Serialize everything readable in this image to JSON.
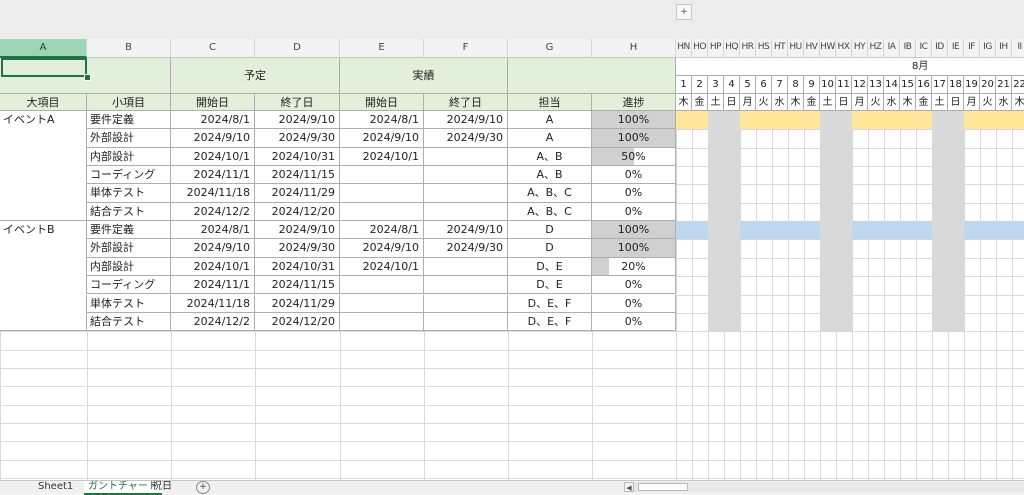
{
  "toolbar": {
    "split_label": "+"
  },
  "columns": [
    "A",
    "B",
    "C",
    "D",
    "E",
    "F",
    "G",
    "H"
  ],
  "gantt_columns": [
    "HN",
    "HO",
    "HP",
    "HQ",
    "HR",
    "HS",
    "HT",
    "HU",
    "HV",
    "HW",
    "HX",
    "HY",
    "HZ",
    "IA",
    "IB",
    "IC",
    "ID",
    "IE",
    "IF",
    "IG",
    "IH",
    "II"
  ],
  "selected_column": "A",
  "group_headers": {
    "plan": "予定",
    "actual": "実績"
  },
  "sub_headers": [
    "大項目",
    "小項目",
    "開始日",
    "終了日",
    "開始日",
    "終了日",
    "担当",
    "進捗"
  ],
  "month_label": "8月",
  "days": [
    "1",
    "2",
    "3",
    "4",
    "5",
    "6",
    "7",
    "8",
    "9",
    "10",
    "11",
    "12",
    "13",
    "14",
    "15",
    "16",
    "17",
    "18",
    "19",
    "20",
    "21",
    "22"
  ],
  "weekdays": [
    "木",
    "金",
    "土",
    "日",
    "月",
    "火",
    "水",
    "木",
    "金",
    "土",
    "日",
    "月",
    "火",
    "水",
    "木",
    "金",
    "土",
    "日",
    "月",
    "火",
    "水",
    "木"
  ],
  "weekend_indices": [
    2,
    3,
    9,
    10,
    16,
    17
  ],
  "rows": [
    {
      "major": "イベントA",
      "minor": "要件定義",
      "plan_start": "2024/8/1",
      "plan_end": "2024/9/10",
      "act_start": "2024/8/1",
      "act_end": "2024/9/10",
      "owner": "A",
      "progress": "100%",
      "progress_value": 1.0
    },
    {
      "major": "",
      "minor": "外部設計",
      "plan_start": "2024/9/10",
      "plan_end": "2024/9/30",
      "act_start": "2024/9/10",
      "act_end": "2024/9/30",
      "owner": "A",
      "progress": "100%",
      "progress_value": 1.0
    },
    {
      "major": "",
      "minor": "内部設計",
      "plan_start": "2024/10/1",
      "plan_end": "2024/10/31",
      "act_start": "2024/10/1",
      "act_end": "",
      "owner": "A、B",
      "progress": "50%",
      "progress_value": 0.5
    },
    {
      "major": "",
      "minor": "コーディング",
      "plan_start": "2024/11/1",
      "plan_end": "2024/11/15",
      "act_start": "",
      "act_end": "",
      "owner": "A、B",
      "progress": "0%",
      "progress_value": 0
    },
    {
      "major": "",
      "minor": "単体テスト",
      "plan_start": "2024/11/18",
      "plan_end": "2024/11/29",
      "act_start": "",
      "act_end": "",
      "owner": "A、B、C",
      "progress": "0%",
      "progress_value": 0
    },
    {
      "major": "",
      "minor": "結合テスト",
      "plan_start": "2024/12/2",
      "plan_end": "2024/12/20",
      "act_start": "",
      "act_end": "",
      "owner": "A、B、C",
      "progress": "0%",
      "progress_value": 0
    },
    {
      "major": "イベントB",
      "minor": "要件定義",
      "plan_start": "2024/8/1",
      "plan_end": "2024/9/10",
      "act_start": "2024/8/1",
      "act_end": "2024/9/10",
      "owner": "D",
      "progress": "100%",
      "progress_value": 1.0
    },
    {
      "major": "",
      "minor": "外部設計",
      "plan_start": "2024/9/10",
      "plan_end": "2024/9/30",
      "act_start": "2024/9/10",
      "act_end": "2024/9/30",
      "owner": "D",
      "progress": "100%",
      "progress_value": 1.0
    },
    {
      "major": "",
      "minor": "内部設計",
      "plan_start": "2024/10/1",
      "plan_end": "2024/10/31",
      "act_start": "2024/10/1",
      "act_end": "",
      "owner": "D、E",
      "progress": "20%",
      "progress_value": 0.2
    },
    {
      "major": "",
      "minor": "コーディング",
      "plan_start": "2024/11/1",
      "plan_end": "2024/11/15",
      "act_start": "",
      "act_end": "",
      "owner": "D、E",
      "progress": "0%",
      "progress_value": 0
    },
    {
      "major": "",
      "minor": "単体テスト",
      "plan_start": "2024/11/18",
      "plan_end": "2024/11/29",
      "act_start": "",
      "act_end": "",
      "owner": "D、E、F",
      "progress": "0%",
      "progress_value": 0
    },
    {
      "major": "",
      "minor": "結合テスト",
      "plan_start": "2024/12/2",
      "plan_end": "2024/12/20",
      "act_start": "",
      "act_end": "",
      "owner": "D、E、F",
      "progress": "0%",
      "progress_value": 0
    }
  ],
  "highlight_rows": [
    {
      "row": 0,
      "color": "#ffe699"
    },
    {
      "row": 6,
      "color": "#bdd7ee"
    }
  ],
  "colors": {
    "weekend": "#d9d9d9",
    "header_fill": "#e2efda",
    "selected": "#217346"
  },
  "sheets": [
    "Sheet1",
    "ガントチャート",
    "祝日"
  ],
  "active_sheet": 1,
  "add_sheet_label": "+",
  "scroll_left_label": "◀"
}
